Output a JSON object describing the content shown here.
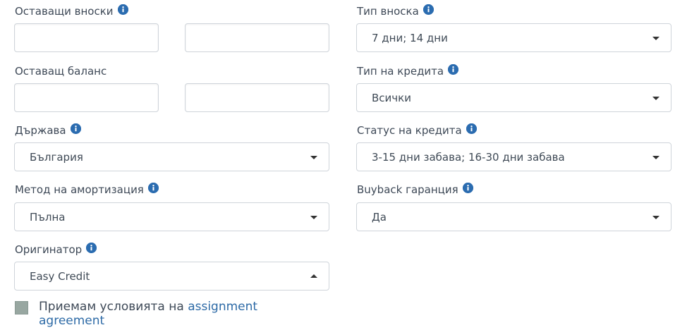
{
  "labels": {
    "remaining_installments": "Оставащи вноски",
    "installment_type": "Тип вноска",
    "remaining_balance": "Оставащ баланс",
    "loan_type": "Тип на кредита",
    "country": "Държава",
    "loan_status": "Статус на кредита",
    "amortization_method": "Метод на амортизация",
    "buyback_guarantee": "Buyback гаранция",
    "originator": "Оригинатор"
  },
  "inputs": {
    "remaining_installments_from": "",
    "remaining_installments_to": "",
    "remaining_balance_from": "",
    "remaining_balance_to": ""
  },
  "selects": {
    "installment_type": "7 дни; 14 дни",
    "loan_type": "Всички",
    "country": "България",
    "loan_status": "3-15 дни забава; 16-30 дни забава",
    "amortization_method": "Пълна",
    "buyback_guarantee": "Да",
    "originator": "Easy Credit"
  },
  "terms": {
    "prefix": "Приемам условията на ",
    "link": "assignment agreement",
    "checked": false
  },
  "icons": {
    "info": "info-icon",
    "caret_down": "chevron-down-icon",
    "caret_up": "chevron-up-icon"
  },
  "colors": {
    "info_icon": "#2b6cb0",
    "link": "#2d6aa6",
    "checkbox": "#98a7a1"
  }
}
